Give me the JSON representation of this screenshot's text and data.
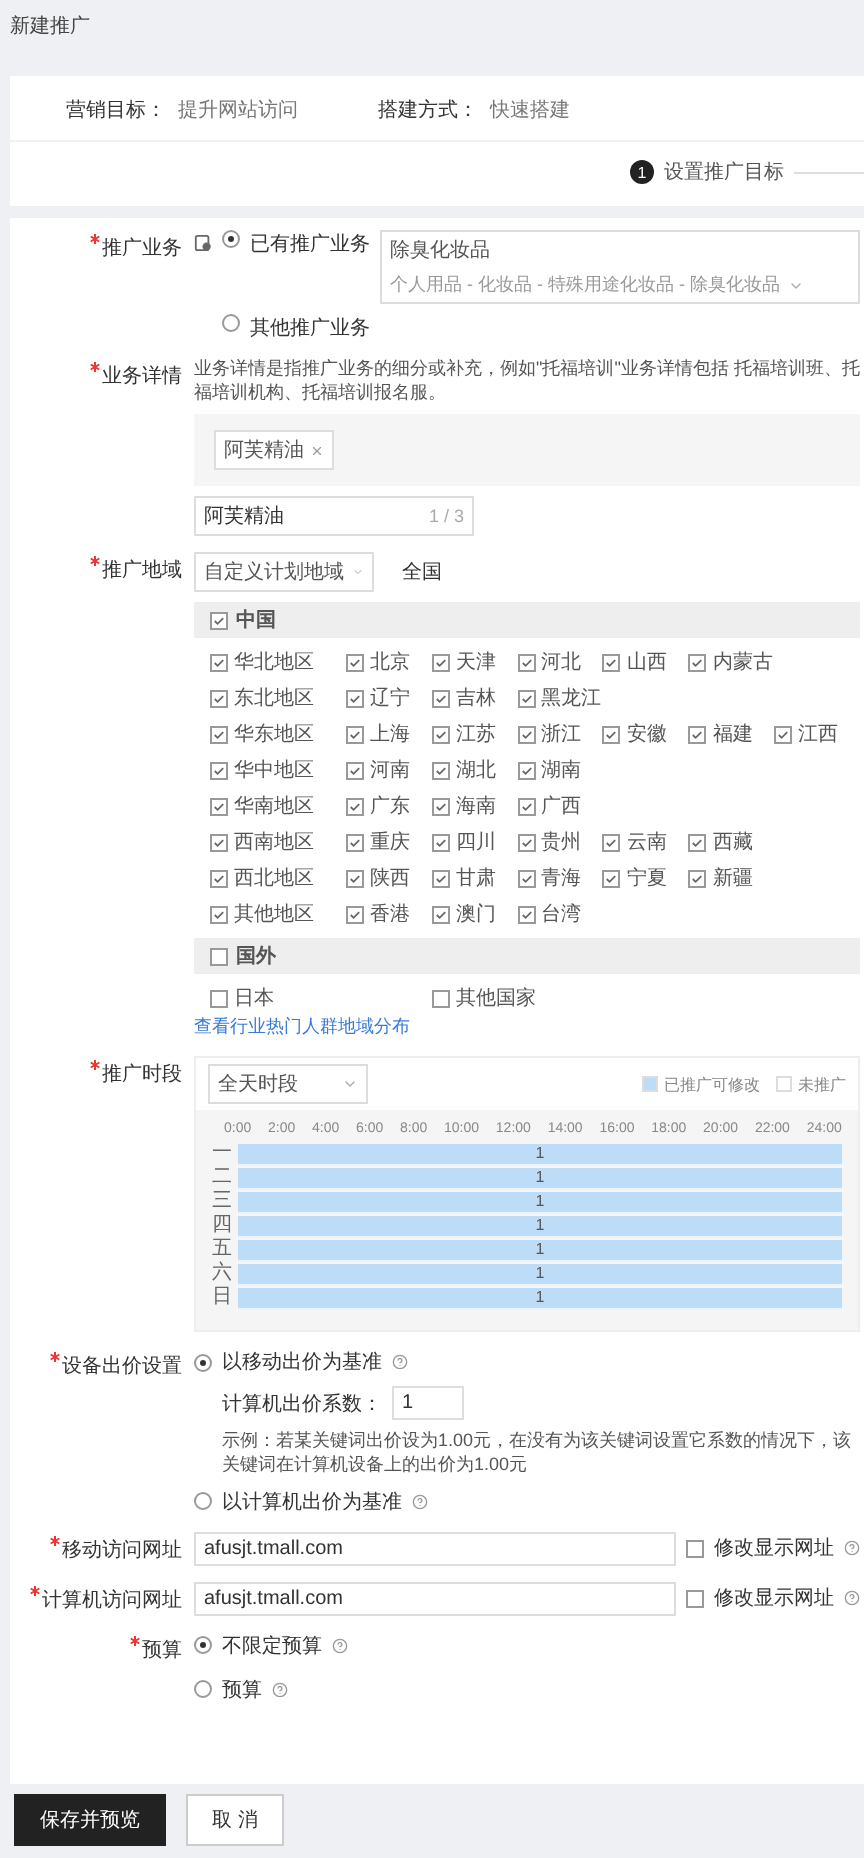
{
  "page_title": "新建推广",
  "meta": [
    {
      "label": "营销目标：",
      "value": "提升网站访问"
    },
    {
      "label": "搭建方式：",
      "value": "快速搭建"
    }
  ],
  "steps": [
    {
      "number": "1",
      "label": "设置推广目标",
      "selected": true
    }
  ],
  "business": {
    "label": "推广业务",
    "required": true,
    "options": [
      {
        "label": "已有推广业务",
        "selected": true,
        "select": {
          "value": "除臭化妆品",
          "path": "个人用品 - 化妆品 - 特殊用途化妆品 - 除臭化妆品"
        }
      },
      {
        "label": "其他推广业务",
        "selected": false
      }
    ]
  },
  "details": {
    "label": "业务详情",
    "required": true,
    "hint": "业务详情是指推广业务的细分或补充，例如\"托福培训\"业务详情包括 托福培训班、托福培训机构、托福培训报名服。",
    "tags": [
      "阿芙精油"
    ],
    "input": {
      "value": "阿芙精油",
      "counter": "1 / 3"
    }
  },
  "region": {
    "label": "推广地域",
    "required": true,
    "select": "自定义计划地域",
    "scope": "全国",
    "groups": [
      {
        "name": "中国",
        "checked": true,
        "rows": [
          {
            "name": "华北地区",
            "checked": true,
            "items": [
              {
                "name": "北京",
                "checked": true
              },
              {
                "name": "天津",
                "checked": true
              },
              {
                "name": "河北",
                "checked": true
              },
              {
                "name": "山西",
                "checked": true
              },
              {
                "name": "内蒙古",
                "checked": true
              }
            ]
          },
          {
            "name": "东北地区",
            "checked": true,
            "items": [
              {
                "name": "辽宁",
                "checked": true
              },
              {
                "name": "吉林",
                "checked": true
              },
              {
                "name": "黑龙江",
                "checked": true
              }
            ]
          },
          {
            "name": "华东地区",
            "checked": true,
            "items": [
              {
                "name": "上海",
                "checked": true
              },
              {
                "name": "江苏",
                "checked": true
              },
              {
                "name": "浙江",
                "checked": true
              },
              {
                "name": "安徽",
                "checked": true
              },
              {
                "name": "福建",
                "checked": true
              },
              {
                "name": "江西",
                "checked": true
              }
            ]
          },
          {
            "name": "华中地区",
            "checked": true,
            "items": [
              {
                "name": "河南",
                "checked": true
              },
              {
                "name": "湖北",
                "checked": true
              },
              {
                "name": "湖南",
                "checked": true
              }
            ]
          },
          {
            "name": "华南地区",
            "checked": true,
            "items": [
              {
                "name": "广东",
                "checked": true
              },
              {
                "name": "海南",
                "checked": true
              },
              {
                "name": "广西",
                "checked": true
              }
            ]
          },
          {
            "name": "西南地区",
            "checked": true,
            "items": [
              {
                "name": "重庆",
                "checked": true
              },
              {
                "name": "四川",
                "checked": true
              },
              {
                "name": "贵州",
                "checked": true
              },
              {
                "name": "云南",
                "checked": true
              },
              {
                "name": "西藏",
                "checked": true
              }
            ]
          },
          {
            "name": "西北地区",
            "checked": true,
            "items": [
              {
                "name": "陕西",
                "checked": true
              },
              {
                "name": "甘肃",
                "checked": true
              },
              {
                "name": "青海",
                "checked": true
              },
              {
                "name": "宁夏",
                "checked": true
              },
              {
                "name": "新疆",
                "checked": true
              }
            ]
          },
          {
            "name": "其他地区",
            "checked": true,
            "items": [
              {
                "name": "香港",
                "checked": true
              },
              {
                "name": "澳门",
                "checked": true
              },
              {
                "name": "台湾",
                "checked": true
              }
            ]
          }
        ]
      },
      {
        "name": "国外",
        "checked": false,
        "items": [
          {
            "name": "日本",
            "checked": false
          },
          {
            "name": "其他国家",
            "checked": false
          }
        ]
      }
    ],
    "link": "查看行业热门人群地域分布"
  },
  "schedule": {
    "label": "推广时段",
    "required": true,
    "select": "全天时段",
    "legend": [
      {
        "label": "已推广可修改",
        "color": "#bcdcf7"
      },
      {
        "label": "未推广",
        "color": "#ffffff"
      }
    ],
    "hours": [
      "0:00",
      "2:00",
      "4:00",
      "6:00",
      "8:00",
      "10:00",
      "12:00",
      "14:00",
      "16:00",
      "18:00",
      "20:00",
      "22:00",
      "24:00"
    ],
    "days": [
      {
        "day": "一",
        "value": "1",
        "level": 1
      },
      {
        "day": "二",
        "value": "1",
        "level": 1
      },
      {
        "day": "三",
        "value": "1",
        "level": 1
      },
      {
        "day": "四",
        "value": "1",
        "level": 1
      },
      {
        "day": "五",
        "value": "1",
        "level": 1
      },
      {
        "day": "六",
        "value": "1",
        "level": 1
      },
      {
        "day": "日",
        "value": "1",
        "level": 1
      }
    ]
  },
  "device": {
    "label": "设备出价设置",
    "required": true,
    "options": [
      {
        "label": "以移动出价为基准",
        "selected": true,
        "coef_label": "计算机出价系数：",
        "coef_value": "1",
        "example": "示例：若某关键词出价设为1.00元，在没有为该关键词设置它系数的情况下，该关键词在计算机设备上的出价为1.00元"
      },
      {
        "label": "以计算机出价为基准",
        "selected": false
      }
    ]
  },
  "urls": [
    {
      "label": "移动访问网址",
      "required": true,
      "value": "afusjt.tmall.com",
      "option": "修改显示网址",
      "checked": false
    },
    {
      "label": "计算机访问网址",
      "required": true,
      "value": "afusjt.tmall.com",
      "option": "修改显示网址",
      "checked": false
    }
  ],
  "budget": {
    "label": "预算",
    "required": true,
    "options": [
      {
        "label": "不限定预算",
        "selected": true
      },
      {
        "label": "预算",
        "selected": false
      }
    ]
  },
  "buttons": [
    {
      "label": "保存并预览",
      "kind": "primary"
    },
    {
      "label": "取 消",
      "kind": "secondary"
    }
  ]
}
